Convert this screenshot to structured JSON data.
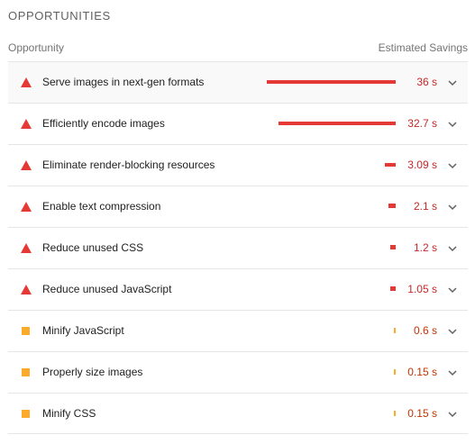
{
  "section": {
    "title": "OPPORTUNITIES"
  },
  "columns": {
    "opportunity": "Opportunity",
    "savings": "Estimated Savings"
  },
  "colors": {
    "fail": "#e53935",
    "average": "#fbaa2c"
  },
  "items": [
    {
      "label": "Serve images in next-gen formats",
      "savings": "36 s",
      "severity": "fail",
      "bar_fraction": 1.0
    },
    {
      "label": "Efficiently encode images",
      "savings": "32.7 s",
      "severity": "fail",
      "bar_fraction": 0.908
    },
    {
      "label": "Eliminate render-blocking resources",
      "savings": "3.09 s",
      "severity": "fail",
      "bar_fraction": 0.086
    },
    {
      "label": "Enable text compression",
      "savings": "2.1 s",
      "severity": "fail",
      "bar_fraction": 0.058
    },
    {
      "label": "Reduce unused CSS",
      "savings": "1.2 s",
      "severity": "fail",
      "bar_fraction": 0.033
    },
    {
      "label": "Reduce unused JavaScript",
      "savings": "1.05 s",
      "severity": "fail",
      "bar_fraction": 0.029
    },
    {
      "label": "Minify JavaScript",
      "savings": "0.6 s",
      "severity": "average",
      "bar_fraction": 0.017
    },
    {
      "label": "Properly size images",
      "savings": "0.15 s",
      "severity": "average",
      "bar_fraction": 0.004
    },
    {
      "label": "Minify CSS",
      "savings": "0.15 s",
      "severity": "average",
      "bar_fraction": 0.004
    }
  ],
  "icons": {
    "fail": "warning-triangle-icon",
    "average": "square-icon",
    "expand": "chevron-down-icon"
  }
}
